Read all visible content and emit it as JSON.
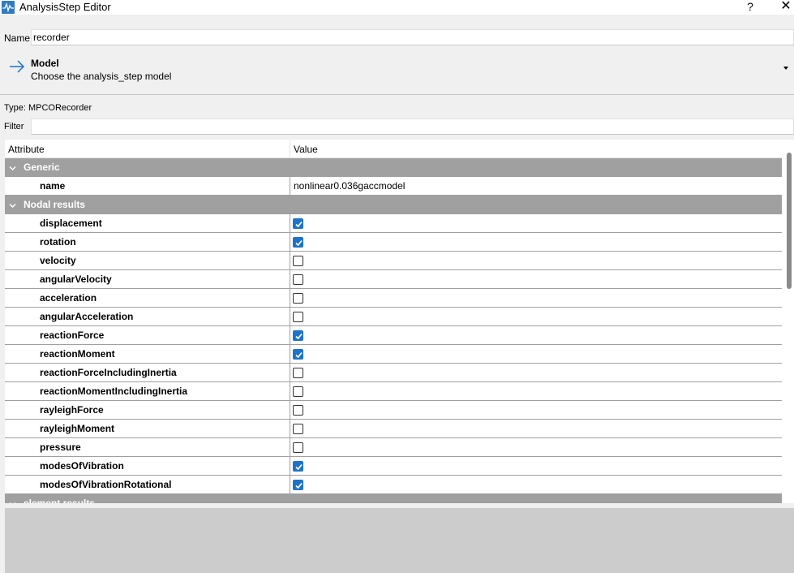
{
  "window": {
    "title": "AnalysisStep Editor",
    "help_label": "?",
    "close_label": "✕"
  },
  "name_field": {
    "label": "Name",
    "value": "recorder"
  },
  "model": {
    "title": "Model",
    "description": "Choose the analysis_step model"
  },
  "type_label": "Type:  MPCORecorder",
  "filter": {
    "label": "Filter",
    "value": ""
  },
  "table": {
    "headers": {
      "attribute": "Attribute",
      "value": "Value"
    },
    "groups": [
      {
        "label": "Generic"
      },
      {
        "label": "Nodal results"
      },
      {
        "label": "element results"
      }
    ],
    "generic_rows": [
      {
        "name": "name",
        "value": "nonlinear0.036gaccmodel"
      }
    ],
    "nodal_rows": [
      {
        "name": "displacement",
        "checked": true
      },
      {
        "name": "rotation",
        "checked": true
      },
      {
        "name": "velocity",
        "checked": false
      },
      {
        "name": "angularVelocity",
        "checked": false
      },
      {
        "name": "acceleration",
        "checked": false
      },
      {
        "name": "angularAcceleration",
        "checked": false
      },
      {
        "name": "reactionForce",
        "checked": true
      },
      {
        "name": "reactionMoment",
        "checked": true
      },
      {
        "name": "reactionForceIncludingInertia",
        "checked": false
      },
      {
        "name": "reactionMomentIncludingInertia",
        "checked": false
      },
      {
        "name": "rayleighForce",
        "checked": false
      },
      {
        "name": "rayleighMoment",
        "checked": false
      },
      {
        "name": "pressure",
        "checked": false
      },
      {
        "name": "modesOfVibration",
        "checked": true
      },
      {
        "name": "modesOfVibrationRotational",
        "checked": true
      }
    ]
  },
  "colors": {
    "accent": "#1e73c8",
    "group_header": "#a0a0a0",
    "bottom_panel": "#cccccc"
  },
  "icons": {
    "app": "app-icon",
    "model": "arrow-right-icon",
    "dropdown": "chevron-down-icon",
    "group": "chevron-down-icon"
  }
}
